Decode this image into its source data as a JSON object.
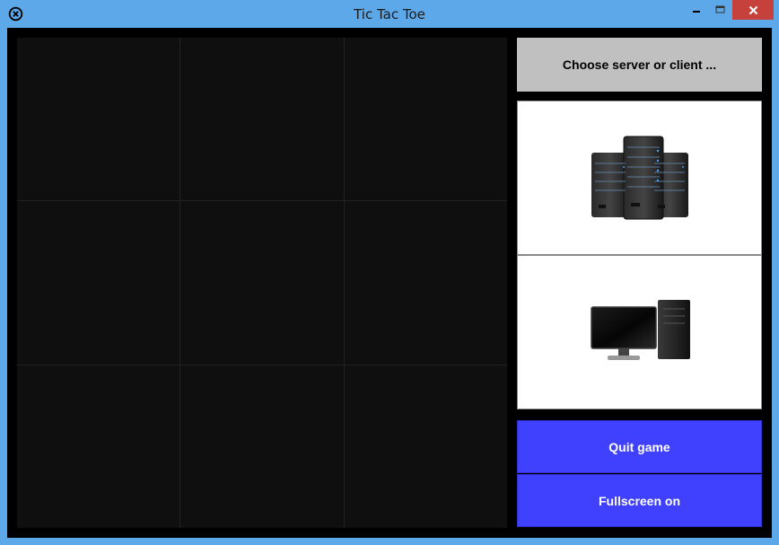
{
  "window": {
    "title": "Tic Tac Toe",
    "icon": "circle-x-icon"
  },
  "title_bar_controls": [
    {
      "name": "minimize",
      "icon": "minimize-icon"
    },
    {
      "name": "maximize",
      "icon": "maximize-icon"
    },
    {
      "name": "close",
      "icon": "close-icon",
      "color": "#c7413c"
    }
  ],
  "board": {
    "rows": 3,
    "cols": 3,
    "cells": [
      "",
      "",
      "",
      "",
      "",
      "",
      "",
      "",
      ""
    ],
    "cell_color": "#0f0f0f"
  },
  "sidebar": {
    "status_text": "Choose server or client ...",
    "options": [
      {
        "name": "server",
        "icon": "server-rack-icon"
      },
      {
        "name": "client",
        "icon": "desktop-computer-icon"
      }
    ],
    "buttons": {
      "quit_label": "Quit game",
      "fullscreen_label": "Fullscreen on"
    }
  },
  "colors": {
    "title_bar": "#5da8e8",
    "close_button": "#c7413c",
    "status_bg": "#c0c0c0",
    "action_button": "#4040ff"
  }
}
